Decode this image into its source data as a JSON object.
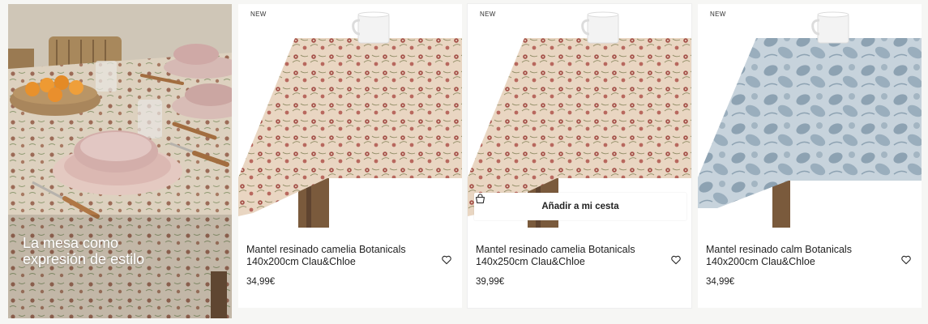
{
  "hero": {
    "caption_line1": "La mesa como",
    "caption_line2": "expresión de estilo"
  },
  "products": [
    {
      "badge": "NEW",
      "title_line1": "Mantel resinado camelia Botanicals",
      "title_line2": "140x200cm Clau&Chloe",
      "price": "34,99€",
      "pattern": "camelia",
      "favorite_icon": "heart-outline-icon"
    },
    {
      "badge": "NEW",
      "title_line1": "Mantel resinado camelia Botanicals",
      "title_line2": "140x250cm Clau&Chloe",
      "price": "39,99€",
      "pattern": "camelia",
      "favorite_icon": "heart-outline-icon",
      "add_to_basket_label": "Añadir a mi cesta",
      "add_to_basket_icon": "basket-icon"
    },
    {
      "badge": "NEW",
      "title_line1": "Mantel resinado calm Botanicals",
      "title_line2": "140x200cm Clau&Chloe",
      "price": "34,99€",
      "pattern": "calm",
      "favorite_icon": "heart-outline-icon"
    }
  ],
  "colors": {
    "camelia_base": "#e9d6c2",
    "camelia_flower": "#a5524a",
    "calm_base": "#c7d3dc",
    "calm_flower": "#8da2b2",
    "table_wood": "#7a5a3c",
    "page_background": "#f6f6f4"
  }
}
